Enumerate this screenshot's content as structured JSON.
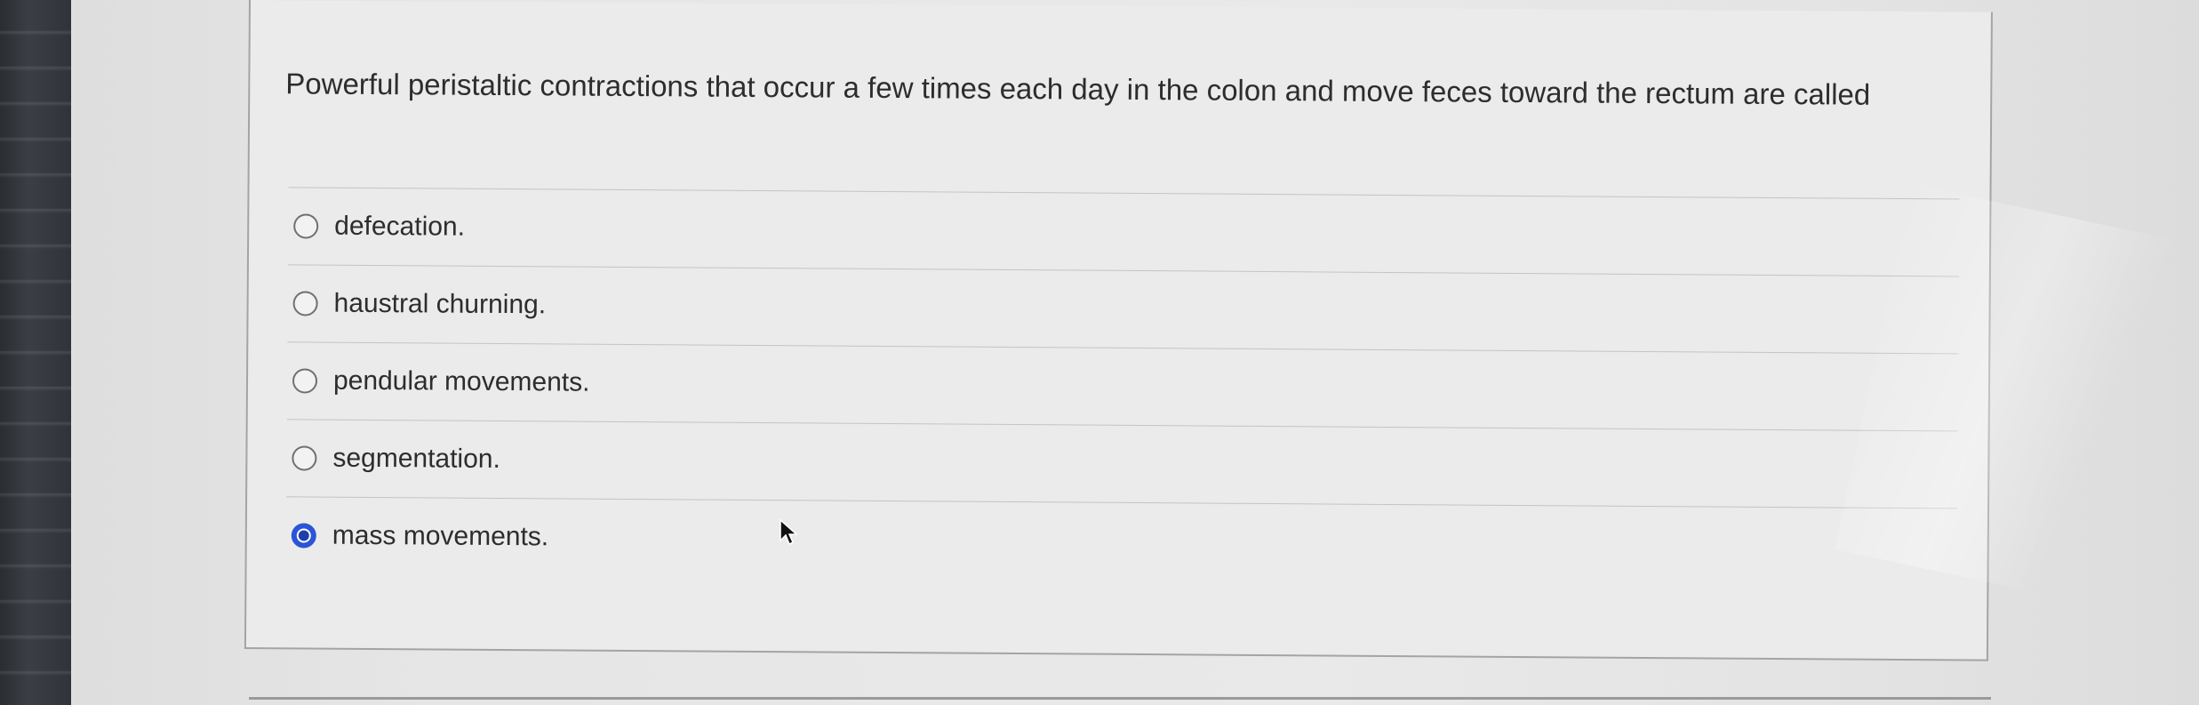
{
  "question": {
    "text": "Powerful peristaltic contractions that occur a few times each day in the colon and move feces toward the rectum are called"
  },
  "choices": [
    {
      "label": "defecation.",
      "selected": false
    },
    {
      "label": "haustral churning.",
      "selected": false
    },
    {
      "label": "pendular movements.",
      "selected": false
    },
    {
      "label": "segmentation.",
      "selected": false
    },
    {
      "label": "mass movements.",
      "selected": true
    }
  ],
  "colors": {
    "selected_radio": "#2b55d6",
    "text": "#2d2d2d",
    "divider": "#c4c4c4"
  },
  "icons": {
    "cursor": "mouse-pointer-icon"
  }
}
